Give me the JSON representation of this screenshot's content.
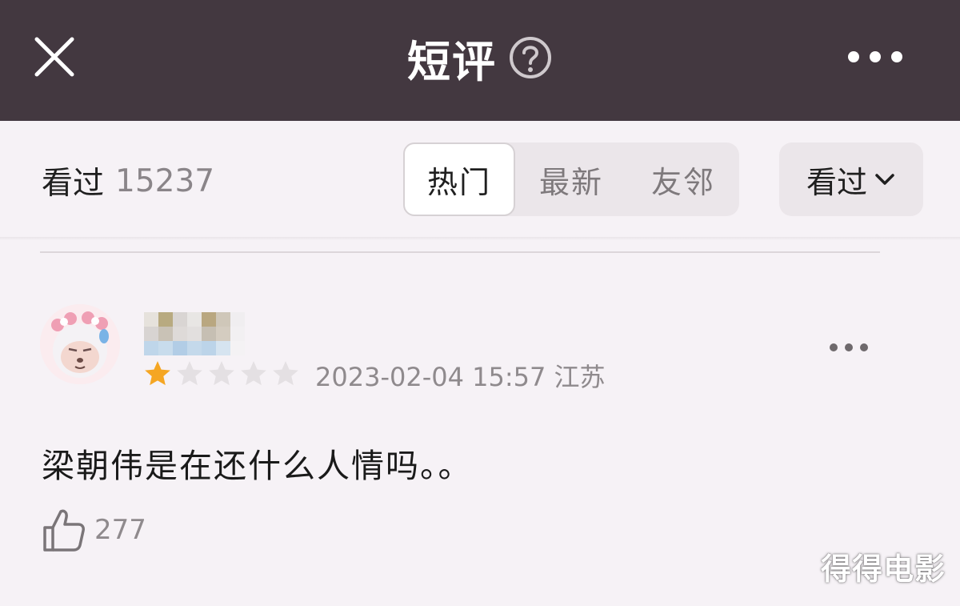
{
  "header": {
    "title": "短评",
    "close_icon": "close-icon",
    "help_icon": "help-icon",
    "more_icon": "more-icon"
  },
  "toolbar": {
    "seen_label": "看过",
    "seen_count": "15237",
    "tabs": [
      {
        "label": "热门",
        "active": true
      },
      {
        "label": "最新",
        "active": false
      },
      {
        "label": "友邻",
        "active": false
      }
    ],
    "filter_label": "看过",
    "filter_icon": "chevron-down-icon"
  },
  "comment": {
    "avatar_icon": "avatar",
    "rating_stars": 1,
    "rating_max": 5,
    "timestamp": "2023-02-04 15:57",
    "location": "江苏",
    "text": "梁朝伟是在还什么人情吗。。",
    "likes": "277",
    "like_icon": "thumbs-up-icon",
    "more_icon": "more-icon"
  },
  "watermark": "得得电影",
  "colors": {
    "header_bg": "#433840",
    "page_bg": "#f6f2f6",
    "star_active": "#f5a623",
    "star_inactive": "#e4e0e3"
  }
}
